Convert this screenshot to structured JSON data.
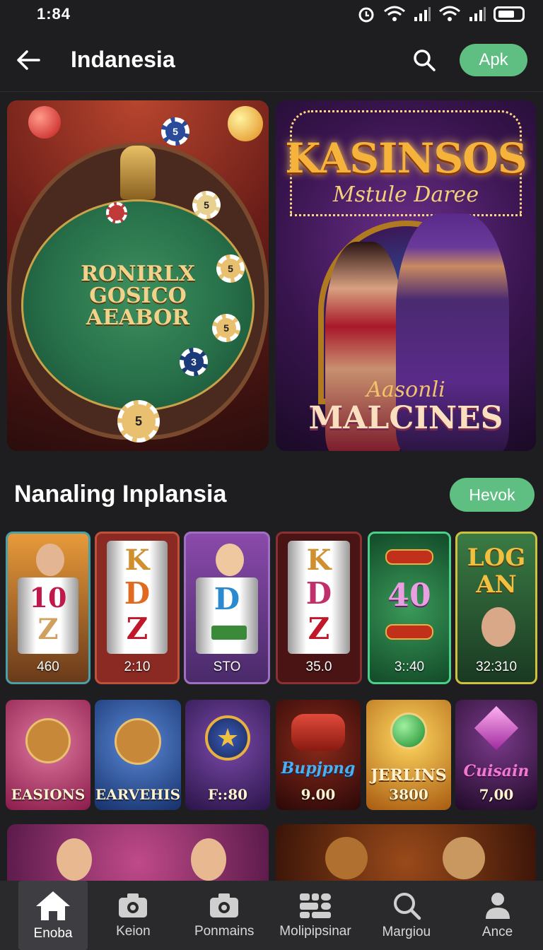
{
  "status_bar": {
    "time": "1:84"
  },
  "app_bar": {
    "title": "Indanesia",
    "apk_label": "Apk"
  },
  "banners": {
    "left": {
      "text_lines": [
        "RONIRLX",
        "GOSICO",
        "AEABOR"
      ],
      "chip_labels": [
        "5",
        "5",
        "5",
        "5",
        "3",
        "5"
      ]
    },
    "right": {
      "title": "KASINSOS",
      "subtitle": "Mstule Daree",
      "script_text": "Aasonli",
      "big_text": "MALCINES"
    }
  },
  "section": {
    "title": "Nanaling Inplansia",
    "button_label": "Hevok"
  },
  "games_row1": [
    {
      "label": "460",
      "border": "#4aa0a8",
      "bg": "#e89a3a",
      "glyphs": [
        "10",
        "Z"
      ]
    },
    {
      "label": "2:10",
      "border": "#c0503a",
      "bg": "#8a2a22",
      "glyphs": [
        "K",
        "D",
        "Z"
      ]
    },
    {
      "label": "STO",
      "border": "#a070c0",
      "bg": "#6a3a8a",
      "glyphs": [
        "D"
      ]
    },
    {
      "label": "35.0",
      "border": "#8a3030",
      "bg": "#4a1414",
      "glyphs": [
        "K",
        "D",
        "Z"
      ]
    },
    {
      "label": "3::40",
      "border": "#4ad08a",
      "bg": "#1f6a3a",
      "glyphs": [
        "40"
      ]
    },
    {
      "label": "32:310",
      "border": "#d0c040",
      "bg": "#2f6a3a",
      "glyphs": [
        "LOG",
        "AN"
      ]
    }
  ],
  "games_row2": [
    {
      "label": "EASIONS",
      "bg": "#c04a7a"
    },
    {
      "label": "EARVEHIS",
      "bg": "#2a5aa8"
    },
    {
      "label": "F::80",
      "bg": "#4a2a7a"
    },
    {
      "label": "9.00",
      "bg": "#3a0e0e",
      "title": "Bupjpng"
    },
    {
      "label": "3800",
      "bg": "#b06a12",
      "title": "JERLINS"
    },
    {
      "label": "7,00",
      "bg": "#3a1a4a",
      "title": "Cuisain"
    }
  ],
  "bottom_nav": [
    {
      "label": "Enoba",
      "icon": "home-icon",
      "active": true
    },
    {
      "label": "Keion",
      "icon": "camera-icon",
      "active": false
    },
    {
      "label": "Ponmains",
      "icon": "camera-icon",
      "active": false
    },
    {
      "label": "Molipipsinar",
      "icon": "grid-icon",
      "active": false
    },
    {
      "label": "Margiou",
      "icon": "search-icon",
      "active": false
    },
    {
      "label": "Ance",
      "icon": "person-icon",
      "active": false
    }
  ],
  "colors": {
    "accent": "#5fbf82",
    "background": "#1e1e20",
    "nav_bg": "#2a2a2d"
  }
}
